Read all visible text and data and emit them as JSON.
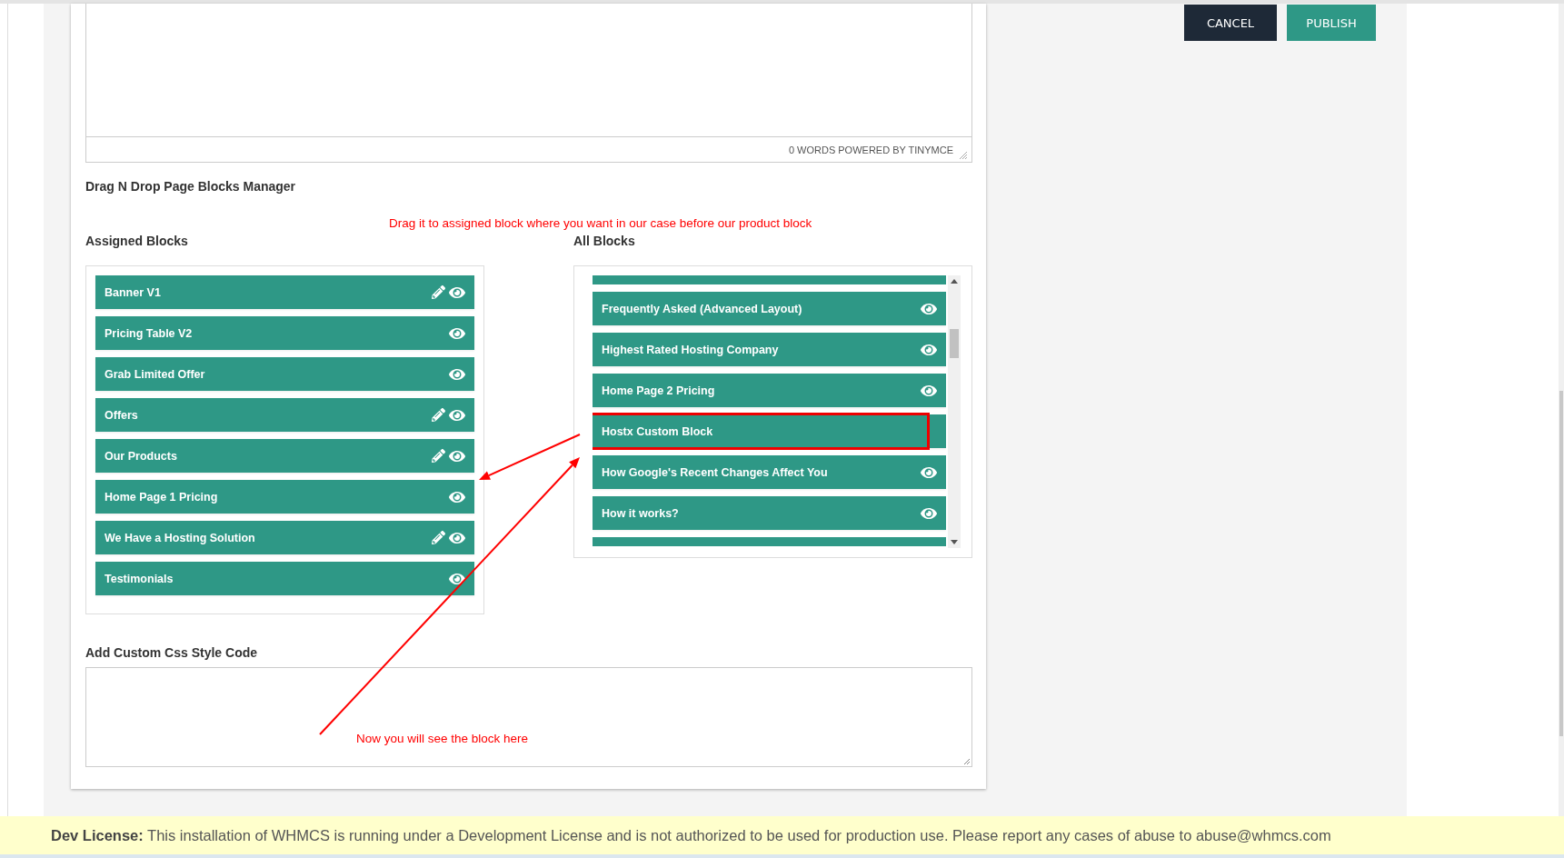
{
  "actions": [
    {
      "label": "CANCEL",
      "kind": "secondary"
    },
    {
      "label": "PUBLISH",
      "kind": "primary"
    }
  ],
  "editor": {
    "status": "0 WORDS POWERED BY TINYMCE"
  },
  "blocks_manager": {
    "title": "Drag N Drop Page Blocks Manager",
    "assigned": {
      "title": "Assigned Blocks",
      "items": [
        {
          "label": "Banner V1",
          "editable": true,
          "previewable": true
        },
        {
          "label": "Pricing Table V2",
          "editable": false,
          "previewable": true
        },
        {
          "label": "Grab Limited Offer",
          "editable": false,
          "previewable": true
        },
        {
          "label": "Offers",
          "editable": true,
          "previewable": true
        },
        {
          "label": "Our Products",
          "editable": true,
          "previewable": true
        },
        {
          "label": "Home Page 1 Pricing",
          "editable": false,
          "previewable": true
        },
        {
          "label": "We Have a Hosting Solution",
          "editable": true,
          "previewable": true
        },
        {
          "label": "Testimonials",
          "editable": false,
          "previewable": true
        }
      ]
    },
    "all": {
      "title": "All Blocks",
      "items": [
        {
          "label": "Frequently Asked (Advanced Layout)",
          "previewable": true,
          "highlighted": false
        },
        {
          "label": "Highest Rated Hosting Company",
          "previewable": true,
          "highlighted": false
        },
        {
          "label": "Home Page 2 Pricing",
          "previewable": true,
          "highlighted": false
        },
        {
          "label": "Hostx Custom Block",
          "previewable": false,
          "highlighted": true
        },
        {
          "label": "How Google's Recent Changes Affect You",
          "previewable": true,
          "highlighted": false
        },
        {
          "label": "How it works?",
          "previewable": true,
          "highlighted": false
        }
      ]
    }
  },
  "custom_css": {
    "label": "Add Custom Css Style Code"
  },
  "annotations": [
    {
      "text": "Drag it to assigned block where you want in our case before our product block"
    },
    {
      "text": "Now you will see the block here"
    }
  ],
  "footer": {
    "notice": "**Dev License:** This installation of WHMCS is running under a Development License and is not authorized to be used for production use. Please report any cases of abuse to abuse@whmcs.com"
  }
}
